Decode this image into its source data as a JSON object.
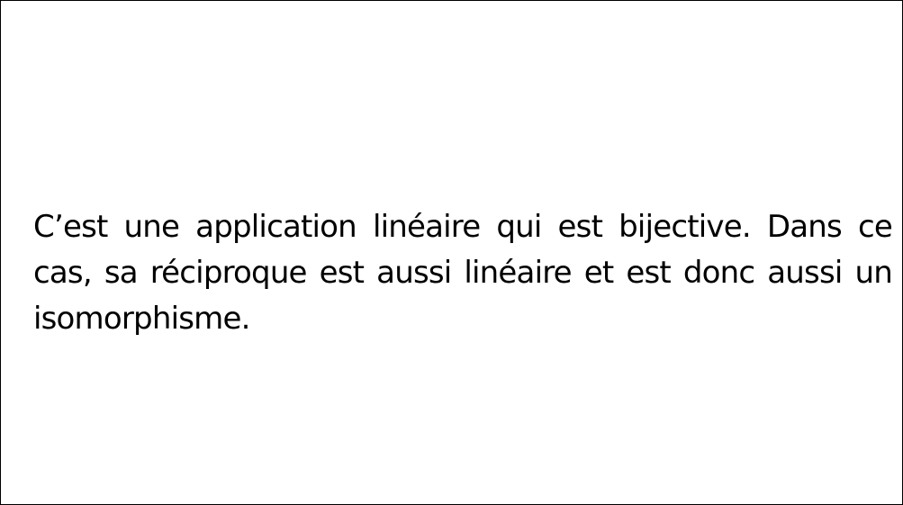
{
  "card": {
    "text": "C’est une application linéaire qui est bijective. Dans ce cas, sa réciproque est aussi linéaire et est donc aussi un isomorphisme."
  },
  "colors": {
    "background": "#ffffff",
    "border": "#000000",
    "text": "#000000"
  }
}
